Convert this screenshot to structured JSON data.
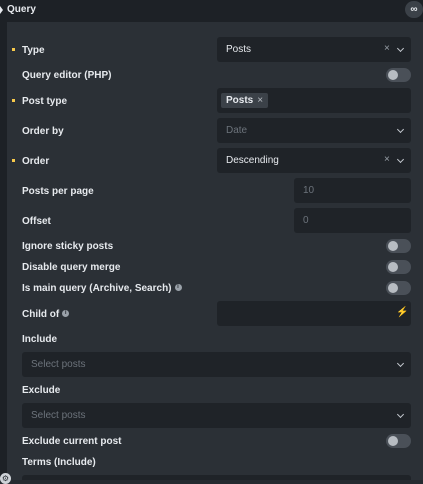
{
  "panel": {
    "title": "Query",
    "link_icon": "∞"
  },
  "fields": {
    "type": {
      "label": "Type",
      "value": "Posts"
    },
    "query_editor": {
      "label": "Query editor (PHP)"
    },
    "post_type": {
      "label": "Post type",
      "tag": "Posts"
    },
    "order_by": {
      "label": "Order by",
      "placeholder": "Date"
    },
    "order": {
      "label": "Order",
      "value": "Descending"
    },
    "posts_per_page": {
      "label": "Posts per page",
      "placeholder": "10"
    },
    "offset": {
      "label": "Offset",
      "placeholder": "0"
    },
    "ignore_sticky": {
      "label": "Ignore sticky posts"
    },
    "disable_merge": {
      "label": "Disable query merge"
    },
    "is_main_query": {
      "label": "Is main query (Archive, Search)"
    },
    "child_of": {
      "label": "Child of"
    },
    "include": {
      "label": "Include",
      "placeholder": "Select posts"
    },
    "exclude": {
      "label": "Exclude",
      "placeholder": "Select posts"
    },
    "exclude_current": {
      "label": "Exclude current post"
    },
    "terms_include": {
      "label": "Terms (Include)"
    }
  },
  "icons": {
    "clear": "×",
    "bolt": "⚡",
    "info": "i",
    "gear": "⚙"
  },
  "colors": {
    "accent_dot": "#f7c94b",
    "panel_bg": "#2b3036",
    "field_bg": "#1f2328"
  }
}
